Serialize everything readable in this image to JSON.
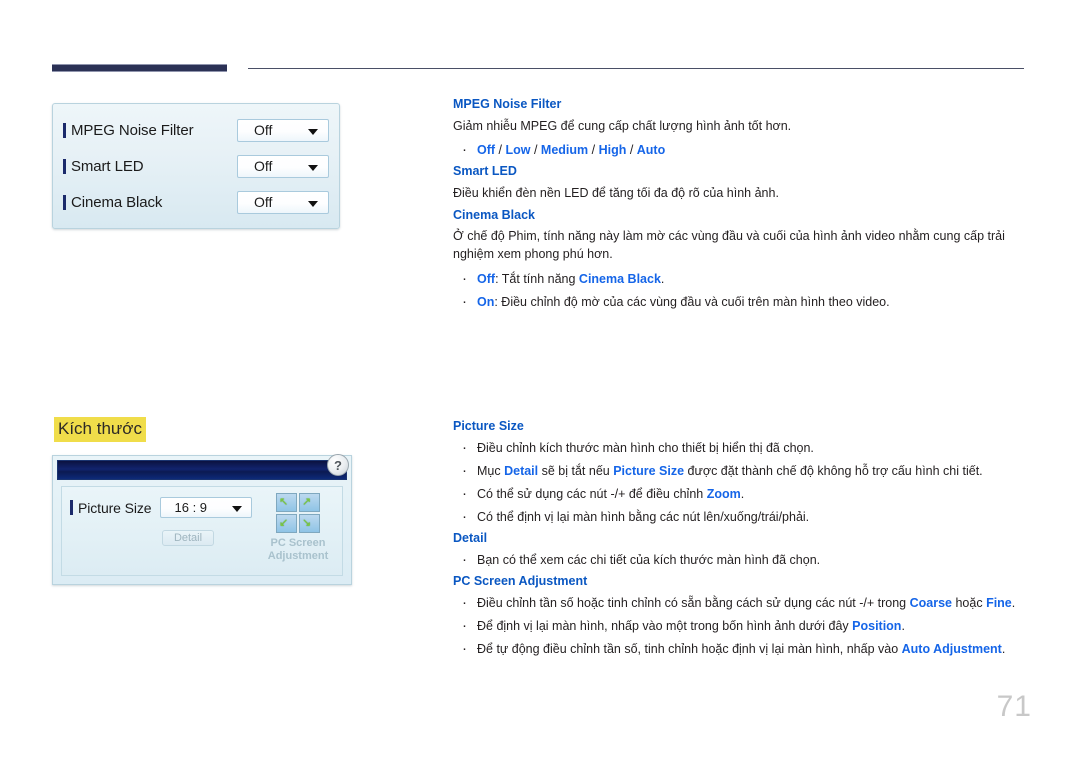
{
  "header": {
    "rule_left_label": "",
    "rule_right_label": ""
  },
  "page": {
    "number": "71"
  },
  "osd_picture_options": {
    "rows": [
      {
        "label": "MPEG Noise Filter",
        "value": "Off",
        "caret": "chevron-down-icon"
      },
      {
        "label": "Smart LED",
        "value": "Off",
        "caret": "chevron-down-icon"
      },
      {
        "label": "Cinema Black",
        "value": "Off",
        "caret": "chevron-down-icon"
      }
    ]
  },
  "section_heading": {
    "text": "Kích thước",
    "highlight_color": "#f0dd4a"
  },
  "osd_picture_size": {
    "help_icon": "?",
    "label": "Picture Size",
    "value": "16 : 9",
    "detail_button": "Detail",
    "pc_screen_adjustment_label": "PC Screen Adjustment",
    "grid_arrows": [
      "↖",
      "↗",
      "↙",
      "↘"
    ]
  },
  "doc_top": {
    "sections": [
      {
        "heading": "MPEG Noise Filter",
        "paragraph": "Giảm nhiễu MPEG để cung cấp chất lượng hình ảnh tốt hơn.",
        "bullets": [
          {
            "plain_prefix": "",
            "items_html": "Off / Low / Medium / High / Auto"
          }
        ]
      },
      {
        "heading": "Smart LED",
        "paragraph": "Điều khiển đèn nền LED để tăng tối đa độ rõ của hình ảnh.",
        "bullets": []
      },
      {
        "heading": "Cinema Black",
        "paragraph": "Ở chế độ Phim, tính năng này làm mờ các vùng đầu và cuối của hình ảnh video nhằm cung cấp trải nghiệm xem phong phú hơn.",
        "bullets": [
          {
            "text": "Off: Tắt tính năng Cinema Black."
          },
          {
            "text": "On: Điều chỉnh độ mờ của các vùng đầu và cuối trên màn hình theo video."
          }
        ]
      }
    ],
    "labels": {
      "mpeg_heading": "MPEG Noise Filter",
      "mpeg_para": "Giảm nhiễu MPEG để cung cấp chất lượng hình ảnh tốt hơn.",
      "mpeg_opt_off": "Off",
      "mpeg_opt_low": "Low",
      "mpeg_opt_medium": "Medium",
      "mpeg_opt_high": "High",
      "mpeg_opt_auto": "Auto",
      "smartled_heading": "Smart LED",
      "smartled_para": "Điều khiển đèn nền LED để tăng tối đa độ rõ của hình ảnh.",
      "cinema_heading": "Cinema Black",
      "cinema_para": "Ở chế độ Phim, tính năng này làm mờ các vùng đầu và cuối của hình ảnh video nhằm cung cấp trải nghiệm xem phong phú hơn.",
      "cinema_off_key": "Off",
      "cinema_off_text": ": Tắt tính năng ",
      "cinema_off_link": "Cinema Black",
      "cinema_off_end": ".",
      "cinema_on_key": "On",
      "cinema_on_text": ": Điều chỉnh độ mờ của các vùng đầu và cuối trên màn hình theo video."
    }
  },
  "doc_bottom": {
    "labels": {
      "picturesize_heading": "Picture Size",
      "ps_b1": "Điều chỉnh kích thước màn hình cho thiết bị hiển thị đã chọn.",
      "ps_b2_a": "Mục ",
      "ps_b2_k1": "Detail",
      "ps_b2_b": " sẽ bị tắt nếu ",
      "ps_b2_k2": "Picture Size",
      "ps_b2_c": " được đặt thành chế độ không hỗ trợ cấu hình chi tiết.",
      "ps_b3_a": "Có thể sử dụng các nút -/+ để điều chỉnh ",
      "ps_b3_k": "Zoom",
      "ps_b3_b": ".",
      "ps_b4": "Có thể định vị lại màn hình bằng các nút lên/xuống/trái/phải.",
      "detail_heading": "Detail",
      "detail_b1": "Bạn có thể xem các chi tiết của kích thước màn hình đã chọn.",
      "pcscreen_heading": "PC Screen Adjustment",
      "pc_b1_a": "Điều chỉnh tần số hoặc tinh chỉnh có sẵn bằng cách sử dụng các nút -/+ trong ",
      "pc_b1_k1": "Coarse",
      "pc_b1_b": " hoặc ",
      "pc_b1_k2": "Fine",
      "pc_b1_c": ".",
      "pc_b2_a": "Để định vị lại màn hình, nhấp vào một trong bốn hình ảnh dưới đây ",
      "pc_b2_k": "Position",
      "pc_b2_b": ".",
      "pc_b3_a": "Để tự động điều chỉnh tần số, tinh chỉnh hoặc định vị lại màn hình, nhấp vào ",
      "pc_b3_k": "Auto Adjustment",
      "pc_b3_b": "."
    }
  },
  "colors": {
    "heading_blue": "#0a57c2",
    "inline_blue": "#1565e8",
    "highlight_yellow": "#f0dd4a",
    "header_navy": "#2b3155",
    "page_number_gray": "#c8c8c8"
  }
}
